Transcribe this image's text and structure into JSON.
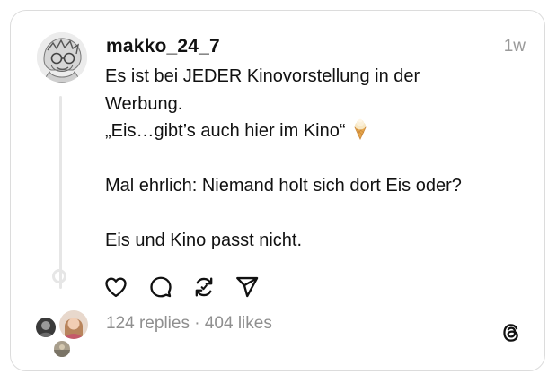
{
  "post": {
    "username": "makko_24_7",
    "timestamp": "1w",
    "lines": [
      "Es ist bei JEDER Kinovorstellung in der",
      "Werbung.",
      "„Eis…gibt’s auch hier im Kino“",
      "Mal ehrlich: Niemand holt sich dort Eis oder?",
      "Eis und Kino passt nicht."
    ],
    "emoji_icon": "ice-cream-cone"
  },
  "actions": {
    "like_icon": "heart-outline",
    "reply_icon": "speech-bubble",
    "repost_icon": "repost-arrows",
    "share_icon": "paper-plane"
  },
  "footer": {
    "replies_likes": "124 replies · 404 likes",
    "logo_icon": "threads-logo"
  },
  "colors": {
    "text": "#111111",
    "muted": "#8f8f8f",
    "border": "#dcdcdc",
    "thread_line": "#e6e6e6"
  }
}
